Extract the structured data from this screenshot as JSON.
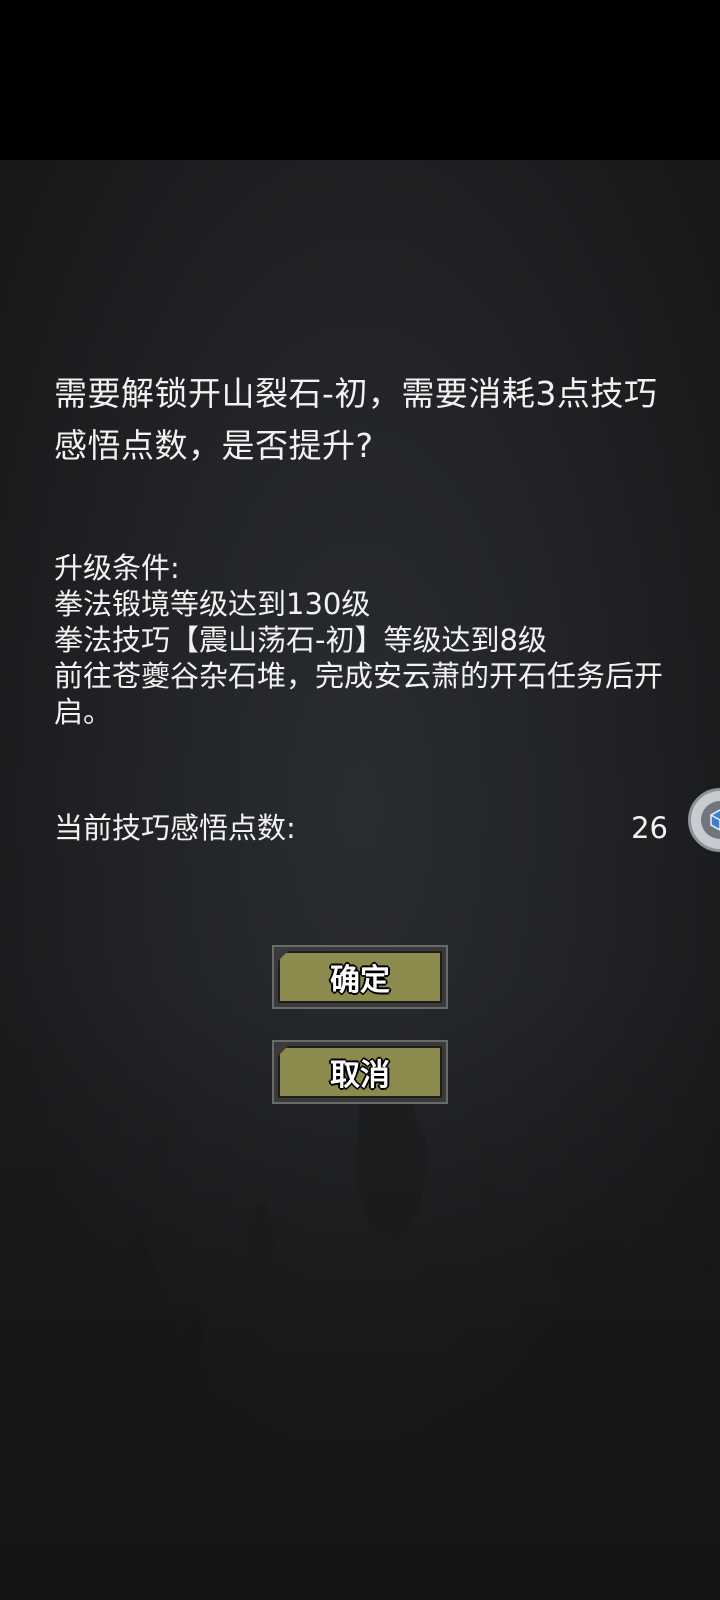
{
  "dialog": {
    "question": "需要解锁开山裂石-初，需要消耗3点技巧感悟点数，是否提升?",
    "conditions_title": "升级条件:",
    "conditions": [
      "拳法锻境等级达到130级",
      "拳法技巧【震山荡石-初】等级达到8级",
      "前往苍夔谷杂石堆，完成安云萧的开石任务后开启。"
    ],
    "points_label": "当前技巧感悟点数:",
    "points_value": "26"
  },
  "buttons": {
    "confirm_label": "确定",
    "cancel_label": "取消"
  },
  "floating_button": {
    "icon": "cube-icon"
  },
  "colors": {
    "button_fill": "#8c8a4c",
    "background": "#222427"
  }
}
